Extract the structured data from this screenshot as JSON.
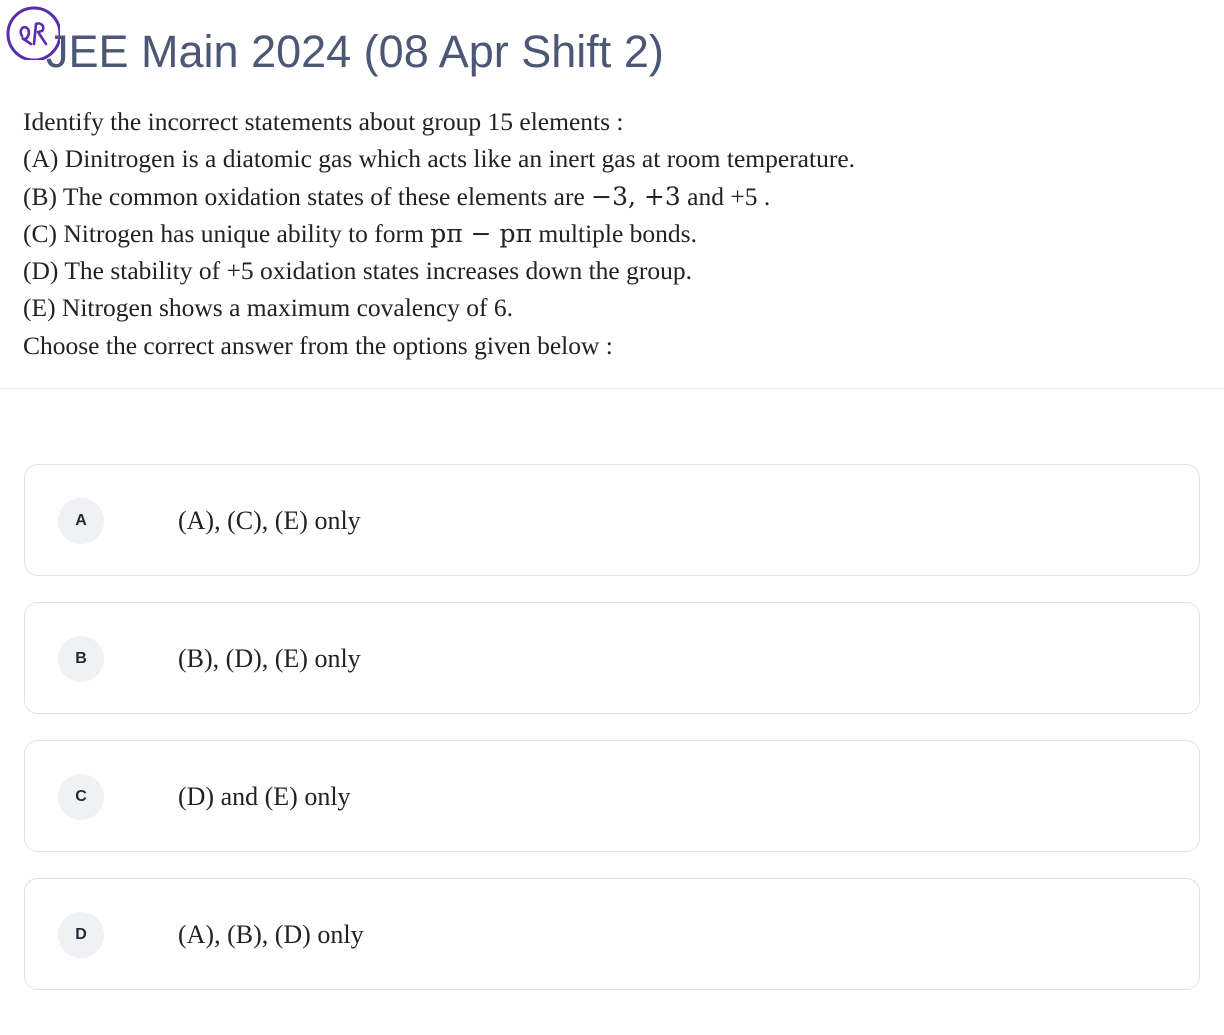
{
  "header": {
    "title": "JEE Main 2024 (08 Apr Shift 2)",
    "logo_icon": "qr-handwritten-logo-icon",
    "logo_color": "#5b2bb0"
  },
  "question": {
    "intro": "Identify the incorrect statements about group 15 elements :",
    "statement_a": "(A) Dinitrogen is a diatomic gas which acts like an inert gas at room temperature.",
    "statement_b_pre": "(B) The common oxidation states of these elements are ",
    "statement_b_math": "−3, +3",
    "statement_b_post": " and +5 .",
    "statement_c_pre": "(C) Nitrogen has unique ability to form ",
    "statement_c_math": "pπ − pπ",
    "statement_c_post": " multiple bonds.",
    "statement_d": "(D) The stability of +5 oxidation states increases down the group.",
    "statement_e": "(E) Nitrogen shows a maximum covalency of 6.",
    "instruction": "Choose the correct answer from the options given below :"
  },
  "options": [
    {
      "letter": "A",
      "text": "(A), (C), (E) only"
    },
    {
      "letter": "B",
      "text": "(B), (D), (E) only"
    },
    {
      "letter": "C",
      "text": "(D) and (E) only"
    },
    {
      "letter": "D",
      "text": "(A), (B), (D) only"
    }
  ],
  "colors": {
    "title": "#4b5775",
    "text": "#222222",
    "option_border": "#dfe2e7",
    "badge_bg": "#f0f1f4"
  }
}
